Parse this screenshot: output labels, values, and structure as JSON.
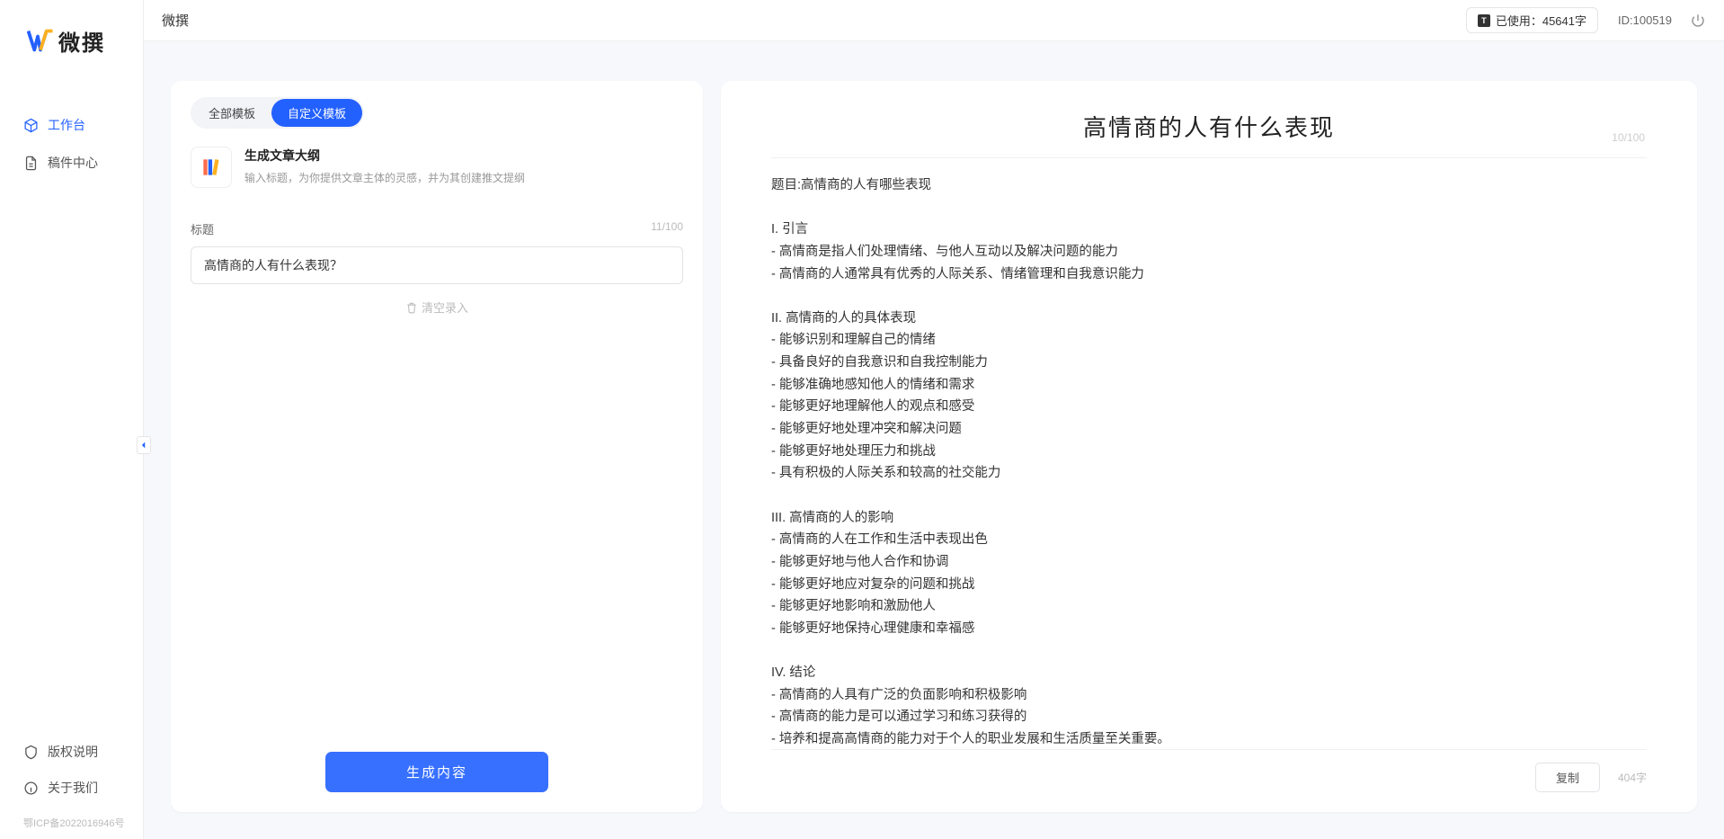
{
  "header": {
    "title": "微撰",
    "usage_label_prefix": "已使用：",
    "usage_value": "45641字",
    "id_label": "ID:100519"
  },
  "logo_text": "微撰",
  "nav": {
    "workbench": "工作台",
    "drafts": "稿件中心",
    "copyright": "版权说明",
    "about": "关于我们"
  },
  "icp": "鄂ICP备2022016946号",
  "left": {
    "tabs": {
      "all": "全部模板",
      "custom": "自定义模板"
    },
    "card_title": "生成文章大纲",
    "card_desc": "输入标题，为你提供文章主体的灵感，并为其创建推文提纲",
    "title_label": "标题",
    "title_counter": "11/100",
    "title_value": "高情商的人有什么表现？",
    "clear_label": "清空录入",
    "gen_label": "生成内容"
  },
  "right": {
    "doc_title": "高情商的人有什么表现",
    "title_counter": "10/100",
    "doc_body": "题目:高情商的人有哪些表现\n\nI. 引言\n- 高情商是指人们处理情绪、与他人互动以及解决问题的能力\n- 高情商的人通常具有优秀的人际关系、情绪管理和自我意识能力\n\nII. 高情商的人的具体表现\n- 能够识别和理解自己的情绪\n- 具备良好的自我意识和自我控制能力\n- 能够准确地感知他人的情绪和需求\n- 能够更好地理解他人的观点和感受\n- 能够更好地处理冲突和解决问题\n- 能够更好地处理压力和挑战\n- 具有积极的人际关系和较高的社交能力\n\nIII. 高情商的人的影响\n- 高情商的人在工作和生活中表现出色\n- 能够更好地与他人合作和协调\n- 能够更好地应对复杂的问题和挑战\n- 能够更好地影响和激励他人\n- 能够更好地保持心理健康和幸福感\n\nIV. 结论\n- 高情商的人具有广泛的负面影响和积极影响\n- 高情商的能力是可以通过学习和练习获得的\n- 培养和提高高情商的能力对于个人的职业发展和生活质量至关重要。",
    "copy_label": "复制",
    "wordcount": "404字"
  }
}
